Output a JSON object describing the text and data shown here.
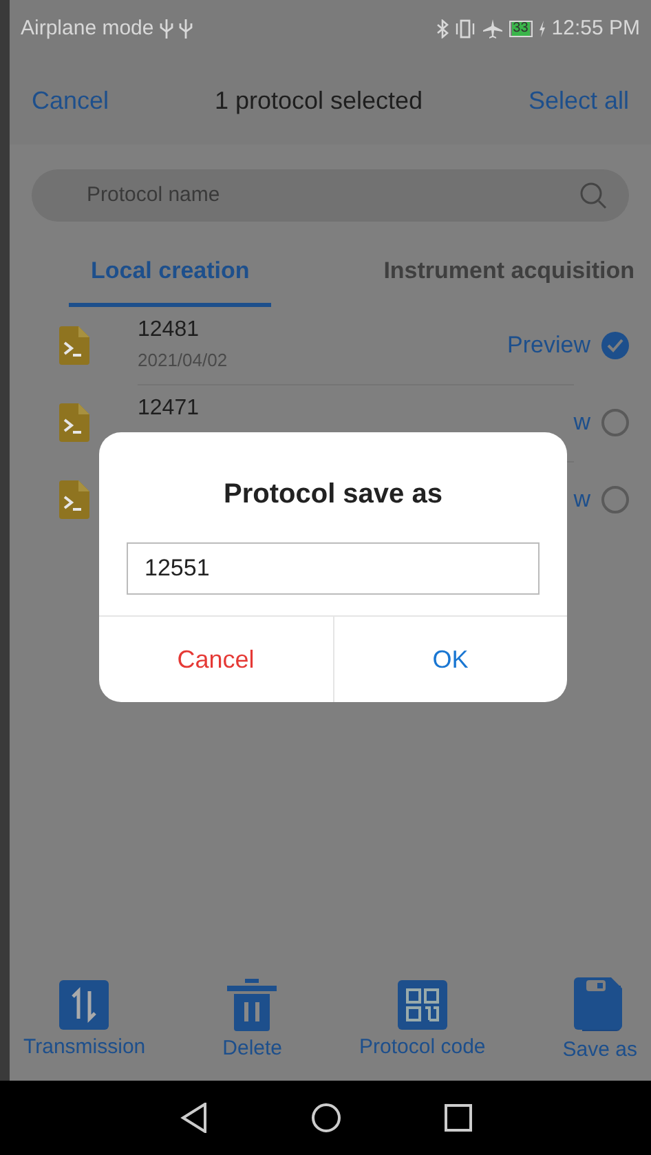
{
  "status_bar": {
    "left": "Airplane mode",
    "battery": "33",
    "time": "12:55 PM"
  },
  "header": {
    "cancel": "Cancel",
    "title": "1 protocol selected",
    "select_all": "Select all"
  },
  "search": {
    "placeholder": "Protocol name"
  },
  "tabs": [
    {
      "label": "Local creation",
      "selected": true
    },
    {
      "label": "Instrument acquisition",
      "selected": false
    }
  ],
  "protocols": [
    {
      "name": "12481",
      "date": "2021/04/02",
      "preview": "Preview",
      "selected": true
    },
    {
      "name": "12471",
      "preview": "w",
      "selected": false
    },
    {
      "preview": "w",
      "selected": false
    }
  ],
  "dialog": {
    "title": "Protocol save as",
    "value": "12551",
    "buttons": [
      {
        "label": "Cancel",
        "kind": "cancel"
      },
      {
        "label": "OK",
        "kind": "ok"
      }
    ]
  },
  "toolbar": [
    {
      "label": "Transmission",
      "kind": "transfer"
    },
    {
      "label": "Delete",
      "kind": "delete"
    },
    {
      "label": "Protocol code",
      "kind": "qr"
    },
    {
      "label": "Save as",
      "kind": "save"
    }
  ]
}
